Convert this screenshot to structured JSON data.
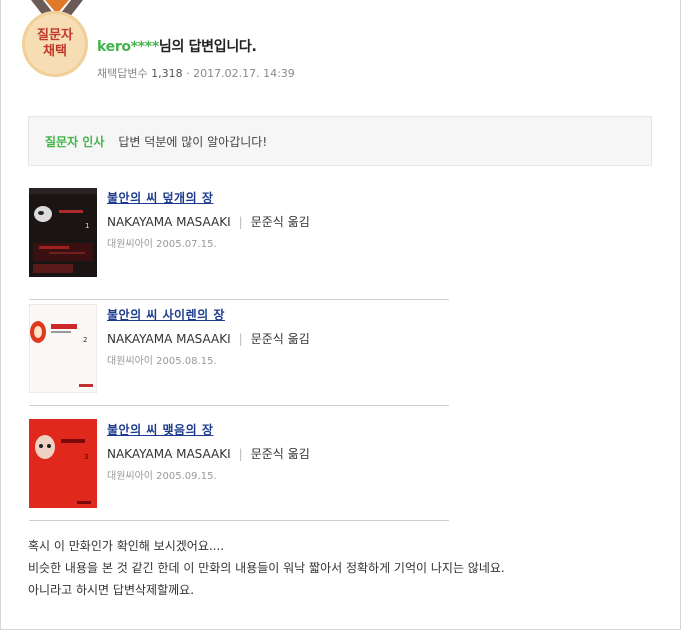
{
  "badge": {
    "line1": "질문자",
    "line2": "채택",
    "colors": {
      "ribbon": "#6b5b56",
      "medal": "#f6ddb3",
      "text": "#c0392b"
    }
  },
  "answer": {
    "author_id": "kero",
    "author_mask": "****",
    "author_suffix": "님의 답변입니다.",
    "adopt_label": "채택답변수",
    "adopt_count": "1,318",
    "separator": "·",
    "date": "2017.02.17. 14:39"
  },
  "greeting": {
    "label": "질문자 인사",
    "text": "답변 덕분에 많이 알아갑니다!"
  },
  "books": [
    {
      "title": "불안의 씨 덮개의 장",
      "author": "NAKAYAMA MASAAKI",
      "translator": "문준식 옮김",
      "publisher_date": "대원씨아이 2005.07.15.",
      "cover_theme": "dark"
    },
    {
      "title": "불안의 씨 사이렌의 장",
      "author": "NAKAYAMA MASAAKI",
      "translator": "문준식 옮김",
      "publisher_date": "대원씨아이 2005.08.15.",
      "cover_theme": "white"
    },
    {
      "title": "불안의 씨 맺음의 장",
      "author": "NAKAYAMA MASAAKI",
      "translator": "문준식 옮김",
      "publisher_date": "대원씨아이 2005.09.15.",
      "cover_theme": "red"
    }
  ],
  "body_lines": [
    "혹시 이 만화인가 확인해 보시겠어요....",
    "비슷한 내용을 본 것 같긴 한데 이 만화의 내용들이 워낙 짧아서 정확하게 기억이 나지는 않네요.",
    "아니라고 하시면 답변삭제할께요."
  ]
}
